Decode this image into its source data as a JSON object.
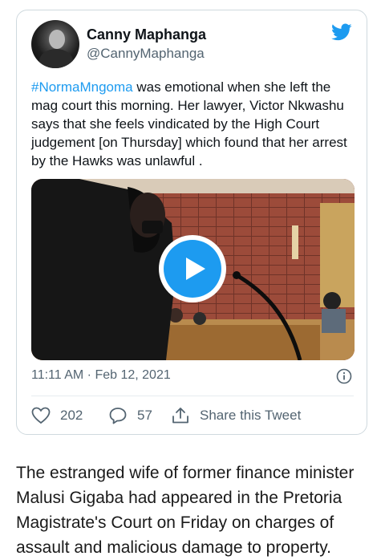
{
  "tweet": {
    "author_name": "Canny Maphanga",
    "author_handle": "@CannyMaphanga",
    "hashtag": "#NormaMngoma",
    "text_after_hashtag": " was emotional when she left the mag court this morning. Her lawyer, Victor Nkwashu says that she feels vindicated by the High Court judgement [on Thursday] which found that her arrest by the Hawks was unlawful .",
    "timestamp": "11:11 AM · Feb 12, 2021",
    "likes_count": "202",
    "replies_count": "57",
    "share_label": "Share this Tweet"
  },
  "article": {
    "paragraph": "The estranged wife of former finance minister Malusi Gigaba had appeared in the Pretoria Magistrate's Court on Friday on charges of assault and malicious damage to property."
  },
  "colors": {
    "accent": "#1d9bf0",
    "secondary_text": "#536471",
    "border": "#cfd9de"
  },
  "icons": [
    "twitter-bird-icon",
    "play-icon",
    "info-icon",
    "heart-icon",
    "reply-icon",
    "share-icon"
  ]
}
